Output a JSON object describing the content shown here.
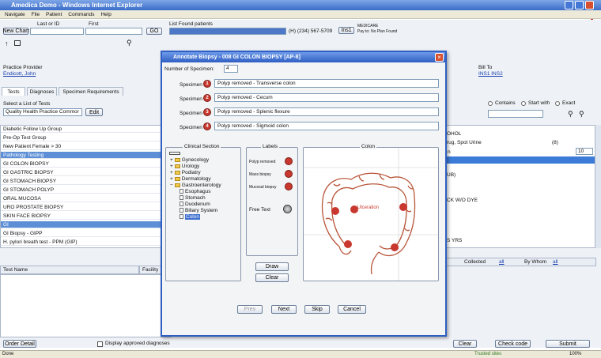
{
  "window": {
    "title": "Amedica Demo - Windows Internet Explorer",
    "badge": "4"
  },
  "menu": [
    "Navigate",
    "File",
    "Patient",
    "Commands",
    "Help"
  ],
  "patient": {
    "last_or_id_label": "Last or ID",
    "first_label": "First",
    "go": "GO",
    "new_chart": "New Chart",
    "list_found": "List Found patients",
    "phone": "(H) (234) 567-5709",
    "ins": "Ins1",
    "medicare": "MEDICARE",
    "medicare_sub": "Pay to: No Plan Found"
  },
  "provider": {
    "label": "Practice Provider",
    "name": "Endicott, John",
    "bill_to": "Bill To",
    "bill_ins": "INS1 INS2"
  },
  "tabs": [
    "Tests",
    "Diagnoses",
    "Specimen Requirements"
  ],
  "left": {
    "select_label": "Select a List of Tests",
    "select_value": "Quality Health Practice Commor",
    "edit": "Edit",
    "items": [
      "Diabetic Follow Up Group",
      "Pre-Op Test Group",
      "New Patient Female > 30",
      "Pathology Testing",
      "GI COLON BIOPSY",
      "GI GASTRIC BIOPSY",
      "GI STOMACH BIOPSY",
      "GI STOMACH POLYP",
      "ORAL MUCOSA",
      "URO PROSTATE BIOPSY",
      "SKIN FACE BIOPSY",
      "GI",
      "GI Biopsy - GIPP",
      "H. pylori breath test - PPM (GIP)"
    ],
    "test_name": "Test Name",
    "facility": "Facility"
  },
  "right": {
    "contains": "Contains",
    "start_with": "Start with",
    "exact": "Exact",
    "rows": [
      "OHOL",
      "rug, Spot Urine",
      "n",
      "UB)",
      "CK W/O DYE",
      "S YRS"
    ],
    "qty": "(8)",
    "dd": "10",
    "collected": "Collected",
    "all": "all",
    "by_whom": "By Whom",
    "all2": "all"
  },
  "dialog": {
    "title": "Annotate Biopsy - 008 GI COLON BIOPSY [AP-8]",
    "num_label": "Number of Specimen:",
    "num_value": "4",
    "specimen_label": "Specimen",
    "specimens": [
      {
        "num": "1",
        "text": "Polyp removed - Transverse colon"
      },
      {
        "num": "2",
        "text": "Polyp removed - Cecum"
      },
      {
        "num": "3",
        "text": "Polyp removed - Splenic flexure"
      },
      {
        "num": "4",
        "text": "Polyp removed - Sigmoid colon"
      }
    ],
    "clinical_section": "Clinical Section",
    "labels": "Labels",
    "colon": "Colon",
    "tree": [
      "Gynecology",
      "Urology",
      "Podiatry",
      "Dermatology",
      "Gastroenterology"
    ],
    "subtree": [
      "Esophagus",
      "Stomach",
      "Duodenum",
      "Biliary System",
      "Colon"
    ],
    "label_items": [
      "Polyp removed",
      "Mass biopsy",
      "Mucosal biopsy"
    ],
    "free_text": "Free Text",
    "draw": "Draw",
    "clear": "Clear",
    "ulceration": "Ulceration",
    "prev": "Prev",
    "next": "Next",
    "skip": "Skip",
    "cancel": "Cancel"
  },
  "bottom": {
    "order_detail": "Order Detail",
    "display_approved": "Display approved diagnoses",
    "clear": "Clear",
    "check_code": "Check code",
    "submit": "Submit"
  },
  "status": {
    "done": "Done",
    "trusted": "Trusted sites",
    "zoom": "100%"
  },
  "colors": {
    "accent": "#3a6cc9",
    "marker": "#c9382f"
  }
}
